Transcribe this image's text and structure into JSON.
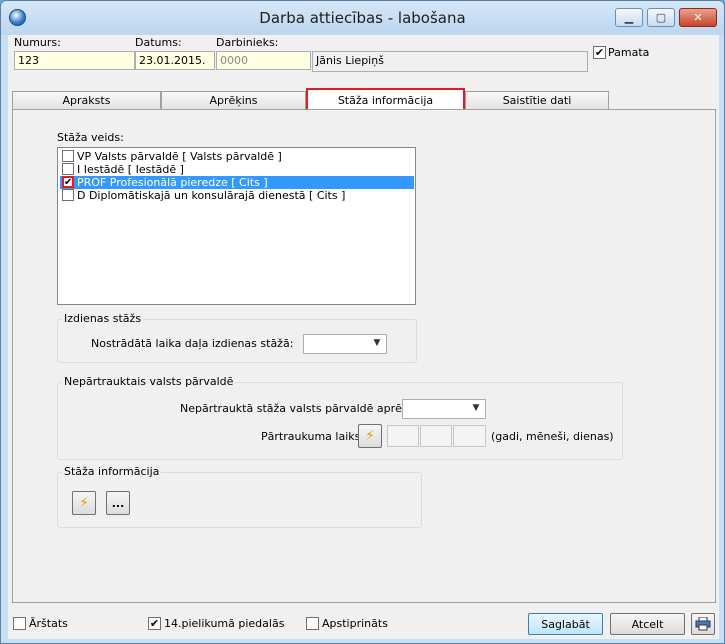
{
  "window": {
    "title": "Darba attiecības - labošana"
  },
  "header": {
    "numurs_label": "Numurs:",
    "numurs_value": "123",
    "datums_label": "Datums:",
    "datums_value": "23.01.2015.",
    "darbinieks_label": "Darbinieks:",
    "darbinieks_code": "0000",
    "darbinieks_name": "Jānis Liepiņš",
    "pamata_label": "Pamata",
    "pamata_checked": true
  },
  "tabs": [
    {
      "label": "Apraksts"
    },
    {
      "label": "Aprēķins"
    },
    {
      "label": "Stāža informācija",
      "active": true
    },
    {
      "label": "Saistītie dati"
    }
  ],
  "staza_veids": {
    "label": "Stāža veids:",
    "items": [
      {
        "label": "VP Valsts pārvaldē [ Valsts pārvaldē ]",
        "checked": false
      },
      {
        "label": "I Iestādē [ Iestādē ]",
        "checked": false
      },
      {
        "label": "PROF Profesionālā pieredze [ Cits ]",
        "checked": true,
        "selected": true
      },
      {
        "label": "D Diplomātiskajā un konsulārajā dienestā [ Cits ]",
        "checked": false
      }
    ]
  },
  "izdienas": {
    "title": "Izdienas stāžs",
    "field_label": "Nostrādātā laika daļa izdienas stāžā:",
    "value": ""
  },
  "nepartraukts": {
    "title": "Nepārtrauktais valsts pārvaldē",
    "calc_label": "Nepārtrauktā stāža valsts pārvaldē aprēķins:",
    "calc_value": "",
    "break_label": "Pārtraukuma laiks:",
    "break_units": "(gadi, mēneši, dienas)"
  },
  "staza_info": {
    "title": "Stāža informācija",
    "more_label": "..."
  },
  "footer": {
    "arstats_label": "Ārštats",
    "arstats_checked": false,
    "pielikums_label": "14.pielikumā piedalās",
    "pielikums_checked": true,
    "apstiprinats_label": "Apstiprināts",
    "apstiprinats_checked": false,
    "save_label": "Saglabāt",
    "cancel_label": "Atcelt"
  },
  "icons": {
    "app": "app-logo-icon",
    "minimize": "minimize-icon",
    "maximize": "maximize-icon",
    "close": "close-icon",
    "lightning": "lightning-icon",
    "print": "printer-icon",
    "dropdown": "chevron-down-icon",
    "check": "checkmark-icon"
  },
  "colors": {
    "highlight_red": "#e31b23",
    "selection_blue": "#3399ff",
    "required_field": "#ffffe1"
  }
}
